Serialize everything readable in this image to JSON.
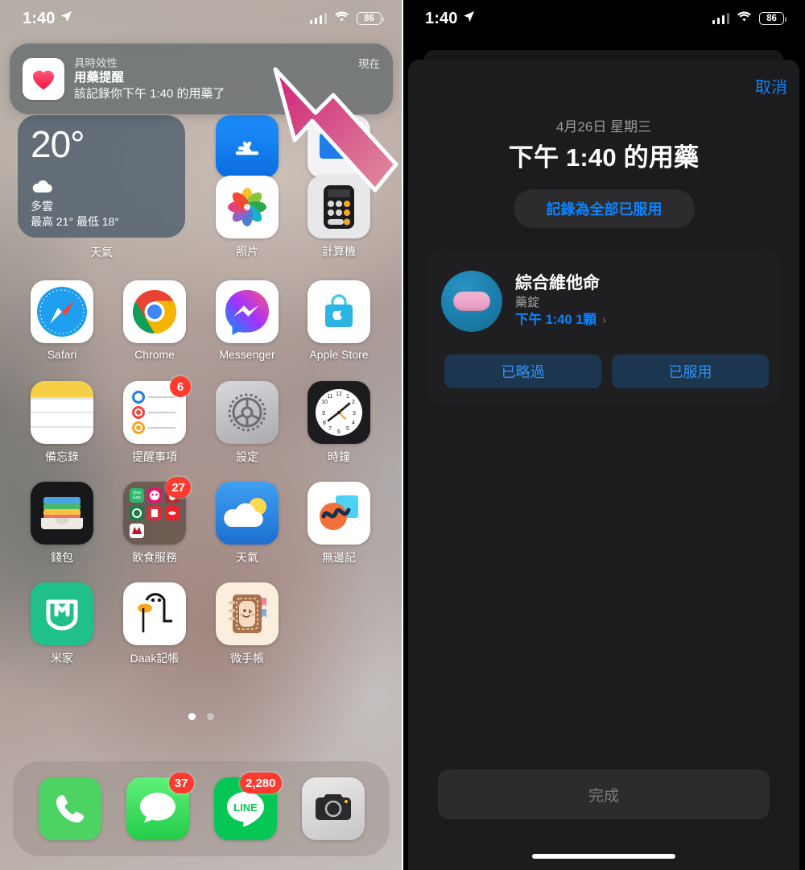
{
  "left_phone": {
    "status_bar": {
      "time": "1:40",
      "location_icon": "location-arrow-icon",
      "signal_icon": "cellular-signal-icon",
      "wifi_icon": "wifi-icon",
      "battery_level": "86"
    },
    "notification": {
      "app_icon": "health-heart-icon",
      "category": "具時效性",
      "title": "用藥提醒",
      "body": "該記錄你下午 1:40 的用藥了",
      "timestamp": "現在"
    },
    "weather_widget": {
      "temperature": "20°",
      "condition_icon": "cloud-icon",
      "condition": "多雲",
      "high_low": "最高 21° 最低 18°",
      "label": "天氣"
    },
    "apps_row1": [
      {
        "label": "App Store",
        "icon": "app-store-icon",
        "badge": ""
      },
      {
        "label": "檔案",
        "icon": "files-icon",
        "badge": ""
      }
    ],
    "apps_row2": [
      {
        "label": "照片",
        "icon": "photos-icon",
        "badge": ""
      },
      {
        "label": "計算機",
        "icon": "calculator-icon",
        "badge": ""
      }
    ],
    "apps_row3": [
      {
        "label": "Safari",
        "icon": "safari-icon",
        "badge": ""
      },
      {
        "label": "Chrome",
        "icon": "chrome-icon",
        "badge": ""
      },
      {
        "label": "Messenger",
        "icon": "messenger-icon",
        "badge": ""
      },
      {
        "label": "Apple Store",
        "icon": "apple-store-icon",
        "badge": ""
      }
    ],
    "apps_row4": [
      {
        "label": "備忘錄",
        "icon": "notes-icon",
        "badge": ""
      },
      {
        "label": "提醒事項",
        "icon": "reminders-icon",
        "badge": "6"
      },
      {
        "label": "設定",
        "icon": "settings-gear-icon",
        "badge": ""
      },
      {
        "label": "時鐘",
        "icon": "clock-icon",
        "badge": ""
      }
    ],
    "apps_row5": [
      {
        "label": "錢包",
        "icon": "wallet-icon",
        "badge": ""
      },
      {
        "label": "飲食服務",
        "icon": "folder-food-icon",
        "badge": "27"
      },
      {
        "label": "天氣",
        "icon": "weather-icon",
        "badge": ""
      },
      {
        "label": "無邊記",
        "icon": "freeform-icon",
        "badge": ""
      }
    ],
    "apps_row6": [
      {
        "label": "米家",
        "icon": "mi-home-icon",
        "badge": ""
      },
      {
        "label": "Daak記帳",
        "icon": "daak-duck-icon",
        "badge": ""
      },
      {
        "label": "微手帳",
        "icon": "notebook-icon",
        "badge": ""
      }
    ],
    "page_dots": {
      "count": 2,
      "active_index": 0
    },
    "dock": [
      {
        "label": "電話",
        "icon": "phone-icon",
        "badge": ""
      },
      {
        "label": "訊息",
        "icon": "messages-icon",
        "badge": "37"
      },
      {
        "label": "LINE",
        "icon": "line-icon",
        "badge": "2,280"
      },
      {
        "label": "相機",
        "icon": "camera-icon",
        "badge": ""
      }
    ],
    "annotation_arrow": {
      "icon": "pointer-arrow-icon",
      "color": "#d9388b"
    }
  },
  "right_phone": {
    "status_bar": {
      "time": "1:40",
      "location_icon": "location-arrow-icon",
      "signal_icon": "cellular-signal-icon",
      "wifi_icon": "wifi-icon",
      "battery_level": "86"
    },
    "sheet": {
      "cancel_label": "取消",
      "date": "4月26日 星期三",
      "title": "下午 1:40 的用藥",
      "log_all_label": "記錄為全部已服用",
      "medication": {
        "icon": "pill-capsule-icon",
        "name": "綜合維他命",
        "form": "藥錠",
        "dose": "下午 1:40 1顆",
        "chevron_icon": "chevron-right-icon",
        "skipped_label": "已略過",
        "taken_label": "已服用"
      },
      "done_label": "完成"
    },
    "home_indicator": "home-indicator"
  },
  "colors": {
    "accent_blue": "#0a84ff",
    "badge_red": "#ff3b30",
    "arrow_pink": "#d9388b",
    "sheet_bg": "#1c1c1e"
  }
}
